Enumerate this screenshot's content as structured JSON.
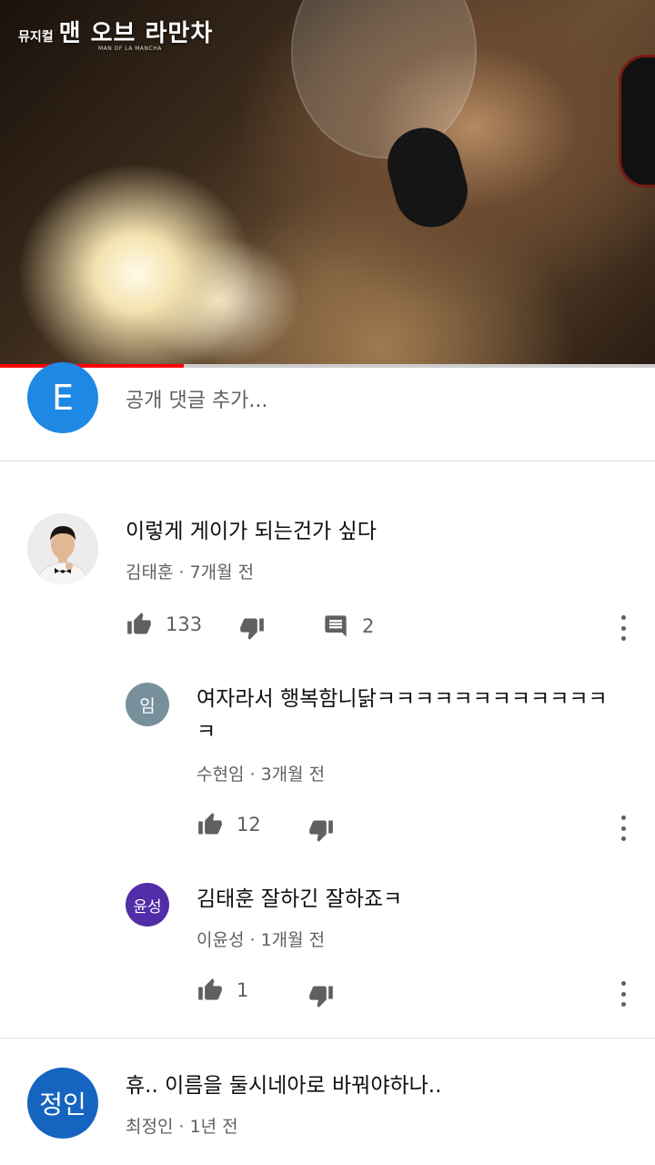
{
  "video": {
    "logo_small": "뮤지컬",
    "logo_big": "맨 오브 라만차",
    "logo_sub": "MAN OF LA MANCHA",
    "progress": 0.28,
    "accent": "#ff0000"
  },
  "add_comment": {
    "avatar_letter": "E",
    "placeholder": "공개 댓글 추가..."
  },
  "comments": [
    {
      "text": "이렇게 게이가 되는건가 싶다",
      "author": "김태훈",
      "time": "7개월 전",
      "likes": "133",
      "replies": "2",
      "avatar": "photo"
    }
  ],
  "replies": [
    {
      "avatar_text": "임",
      "avatar_color": "#78909c",
      "text_line1": "여자라서 행복함니닭ㅋㅋㅋㅋㅋㅋㅋㅋㅋㅋㅋㅋ",
      "text_line2": "ㅋ",
      "author": "수현임",
      "time": "3개월 전",
      "likes": "12"
    },
    {
      "avatar_text": "윤성",
      "avatar_color": "#512da8",
      "text_line1": "김태훈 잘하긴 잘하죠ㅋ",
      "author": "이윤성",
      "time": "1개월 전",
      "likes": "1"
    }
  ],
  "last_comment": {
    "avatar_text": "정인",
    "avatar_color": "#1565c0",
    "text": "휴.. 이름을 둘시네아로 바꿔야하나..",
    "author": "최정인",
    "time": "1년 전"
  },
  "separator": " · "
}
